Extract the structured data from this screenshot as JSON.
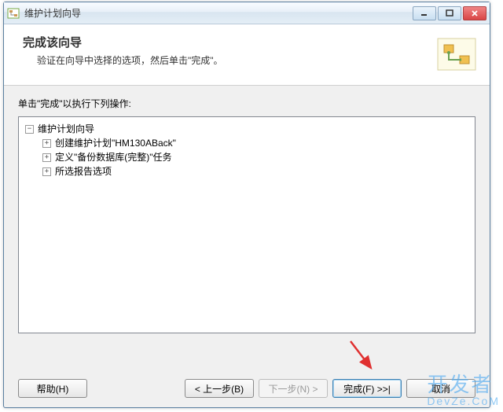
{
  "window": {
    "title": "维护计划向导"
  },
  "header": {
    "title": "完成该向导",
    "description": "验证在向导中选择的选项，然后单击\"完成\"。"
  },
  "content": {
    "instruction": "单击\"完成\"以执行下列操作:"
  },
  "tree": {
    "root_label": "维护计划向导",
    "children": [
      {
        "label": "创建维护计划\"HM130ABack\""
      },
      {
        "label": "定义\"备份数据库(完整)\"任务"
      },
      {
        "label": "所选报告选项"
      }
    ]
  },
  "buttons": {
    "help": "帮助(H)",
    "back": "< 上一步(B)",
    "next": "下一步(N) >",
    "finish": "完成(F) >>|",
    "cancel": "取消"
  },
  "icons": {
    "expand": "+",
    "collapse": "−"
  },
  "watermark": {
    "cn": "开发者",
    "en": "DevZe.CoM"
  }
}
